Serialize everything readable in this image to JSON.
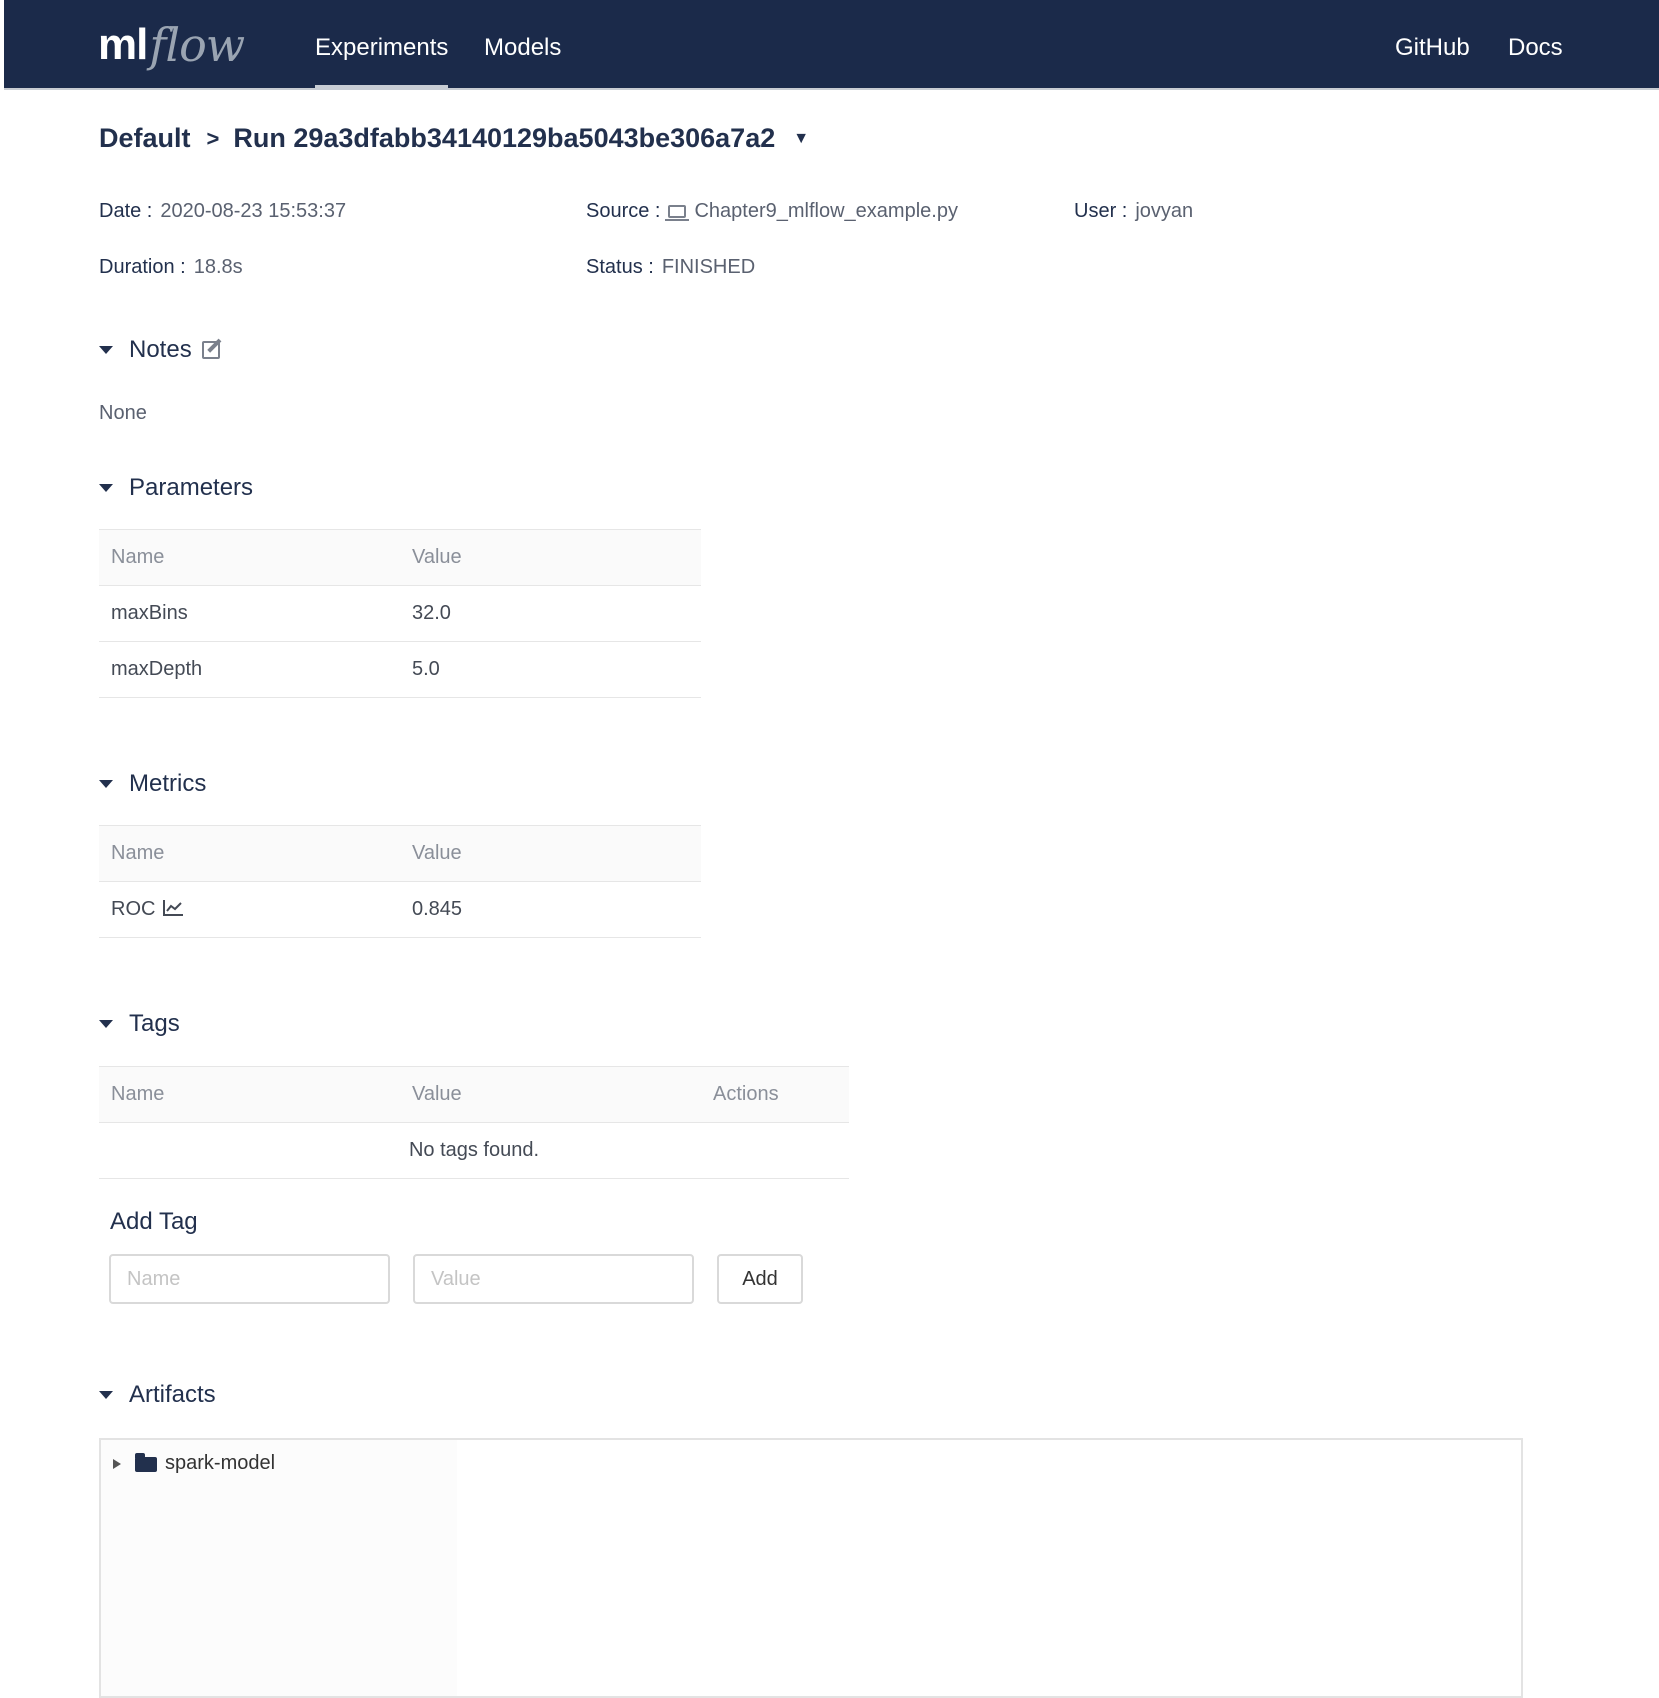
{
  "header": {
    "logo_ml": "ml",
    "logo_flow": "flow",
    "tabs": [
      {
        "label": "Experiments",
        "active": true
      },
      {
        "label": "Models",
        "active": false
      }
    ],
    "links": [
      {
        "label": "GitHub"
      },
      {
        "label": "Docs"
      }
    ]
  },
  "breadcrumb": {
    "experiment": "Default",
    "separator": ">",
    "run": "Run 29a3dfabb34140129ba5043be306a7a2"
  },
  "meta": {
    "date_label": "Date :",
    "date_value": "2020-08-23 15:53:37",
    "duration_label": "Duration :",
    "duration_value": "18.8s",
    "source_label": "Source :",
    "source_value": "Chapter9_mlflow_example.py",
    "status_label": "Status :",
    "status_value": "FINISHED",
    "user_label": "User :",
    "user_value": "jovyan"
  },
  "notes": {
    "title": "Notes",
    "body": "None"
  },
  "parameters": {
    "title": "Parameters",
    "columns": [
      "Name",
      "Value"
    ],
    "rows": [
      {
        "name": "maxBins",
        "value": "32.0"
      },
      {
        "name": "maxDepth",
        "value": "5.0"
      }
    ]
  },
  "metrics": {
    "title": "Metrics",
    "columns": [
      "Name",
      "Value"
    ],
    "rows": [
      {
        "name": "ROC",
        "value": "0.845"
      }
    ]
  },
  "tags": {
    "title": "Tags",
    "columns": [
      "Name",
      "Value",
      "Actions"
    ],
    "empty_text": "No tags found.",
    "add_title": "Add Tag",
    "name_placeholder": "Name",
    "value_placeholder": "Value",
    "add_label": "Add"
  },
  "artifacts": {
    "title": "Artifacts",
    "items": [
      {
        "label": "spark-model"
      }
    ]
  },
  "colors": {
    "header_bg": "#1b2a4a",
    "heading_text": "#22304d"
  }
}
